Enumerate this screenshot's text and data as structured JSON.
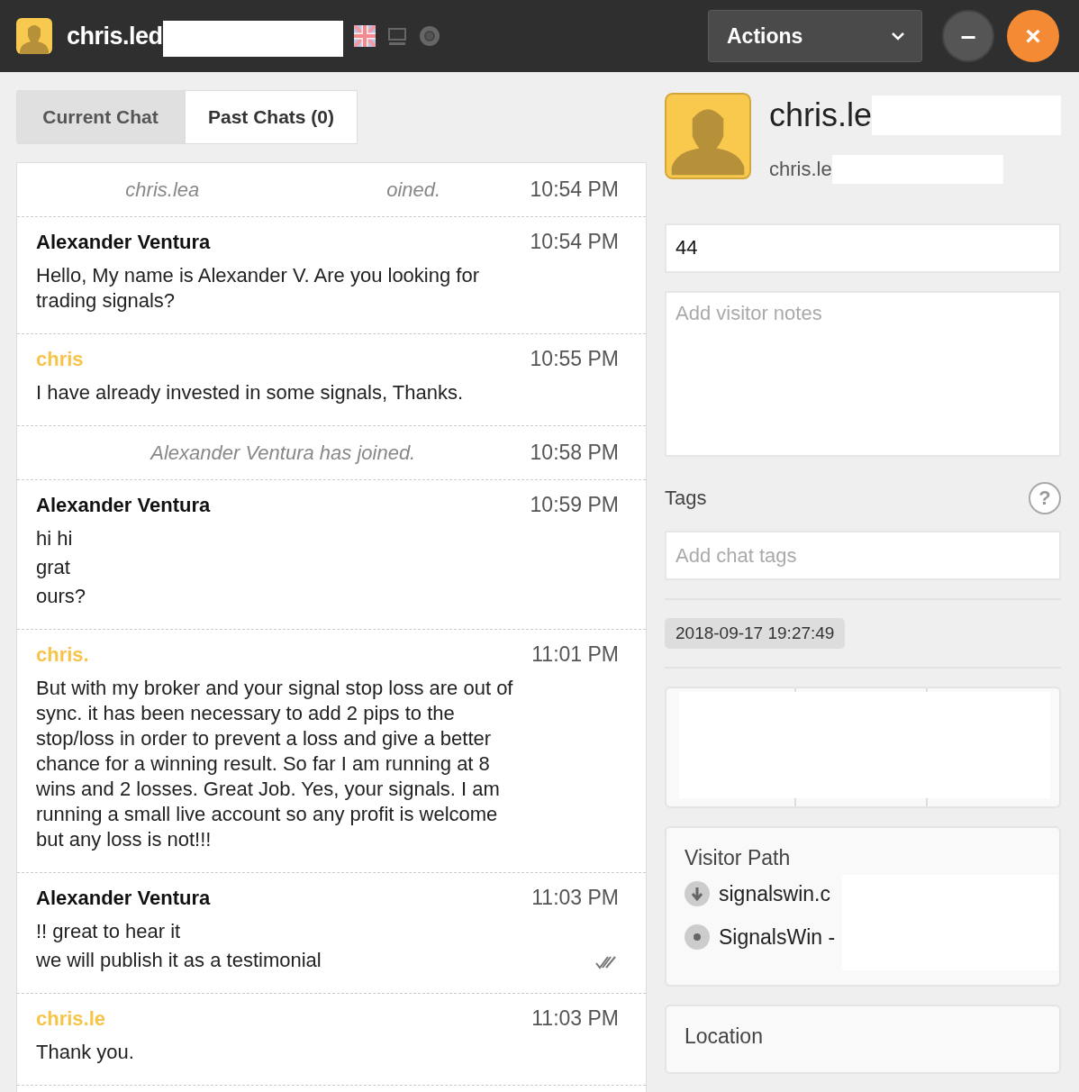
{
  "header": {
    "visitor_name": "chris.led",
    "actions_label": "Actions",
    "minimize_label": "–",
    "close_label": "×"
  },
  "tabs": [
    {
      "label": "Current Chat",
      "selected": true
    },
    {
      "label": "Past Chats (0)",
      "selected": false
    }
  ],
  "messages": [
    {
      "kind": "system",
      "text": "chris.lea",
      "text_end": "oined.",
      "time": "10:54 PM"
    },
    {
      "kind": "message",
      "color": "#111111",
      "author": "Alexander Ventura",
      "time": "10:54 PM",
      "lines": [
        "Hello, My name is Alexander V. Are you looking for trading signals?"
      ],
      "read": false
    },
    {
      "kind": "message",
      "color": "#f7c44a",
      "author": "chris",
      "time": "10:55 PM",
      "lines": [
        "I have already invested in some signals, Thanks."
      ],
      "read": false
    },
    {
      "kind": "system",
      "text": "Alexander Ventura has joined.",
      "time": "10:58 PM"
    },
    {
      "kind": "message",
      "color": "#111111",
      "author": "Alexander Ventura",
      "time": "10:59 PM",
      "lines": [
        "hi hi",
        "grat",
        "ours?"
      ],
      "read": false
    },
    {
      "kind": "message",
      "color": "#f7c44a",
      "author": "chris.",
      "time": "11:01 PM",
      "lines": [
        "But with my broker and your signal stop loss are out of sync. it has been necessary to add 2 pips to the stop/loss in order to prevent a loss and give a better chance for a winning result. So far I am running at 8 wins and 2 losses. Great Job. Yes, your signals. I am running a small live account so any profit is welcome but any loss is not!!!"
      ],
      "read": false
    },
    {
      "kind": "message",
      "color": "#111111",
      "author": "Alexander Ventura",
      "time": "11:03 PM",
      "lines": [
        "!! great to hear it",
        "we will publish it as a testimonial"
      ],
      "read": true
    },
    {
      "kind": "message",
      "color": "#f7c44a",
      "author": "chris.le",
      "time": "11:03 PM",
      "lines": [
        "Thank you."
      ],
      "read": false
    }
  ],
  "profile": {
    "name": "chris.le",
    "subname": "chris.le",
    "phone": "44",
    "notes_placeholder": "Add visitor notes",
    "tags_label": "Tags",
    "help_label": "?",
    "tags_placeholder": "Add chat tags",
    "timestamp": "2018-09-17 19:27:49"
  },
  "visitor_path": {
    "title": "Visitor Path",
    "items": [
      {
        "kind": "arrival",
        "text": "signalswin.c"
      },
      {
        "kind": "page",
        "text": "SignalsWin -"
      }
    ]
  },
  "location": {
    "title": "Location"
  }
}
